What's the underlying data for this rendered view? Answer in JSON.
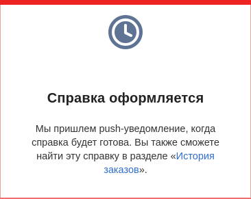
{
  "colors": {
    "accent_red": "#ee2422",
    "icon_fill": "#5f7494",
    "link": "#2f6ecf",
    "title": "#222222",
    "text": "#333333"
  },
  "status": {
    "icon": "clock-icon",
    "title": "Справка оформляется",
    "message_before": "Мы пришлем push-уведомление, когда справка будет готова. Вы также сможете найти эту справку в разделе «",
    "link_text": "История заказов",
    "message_after": "»."
  }
}
